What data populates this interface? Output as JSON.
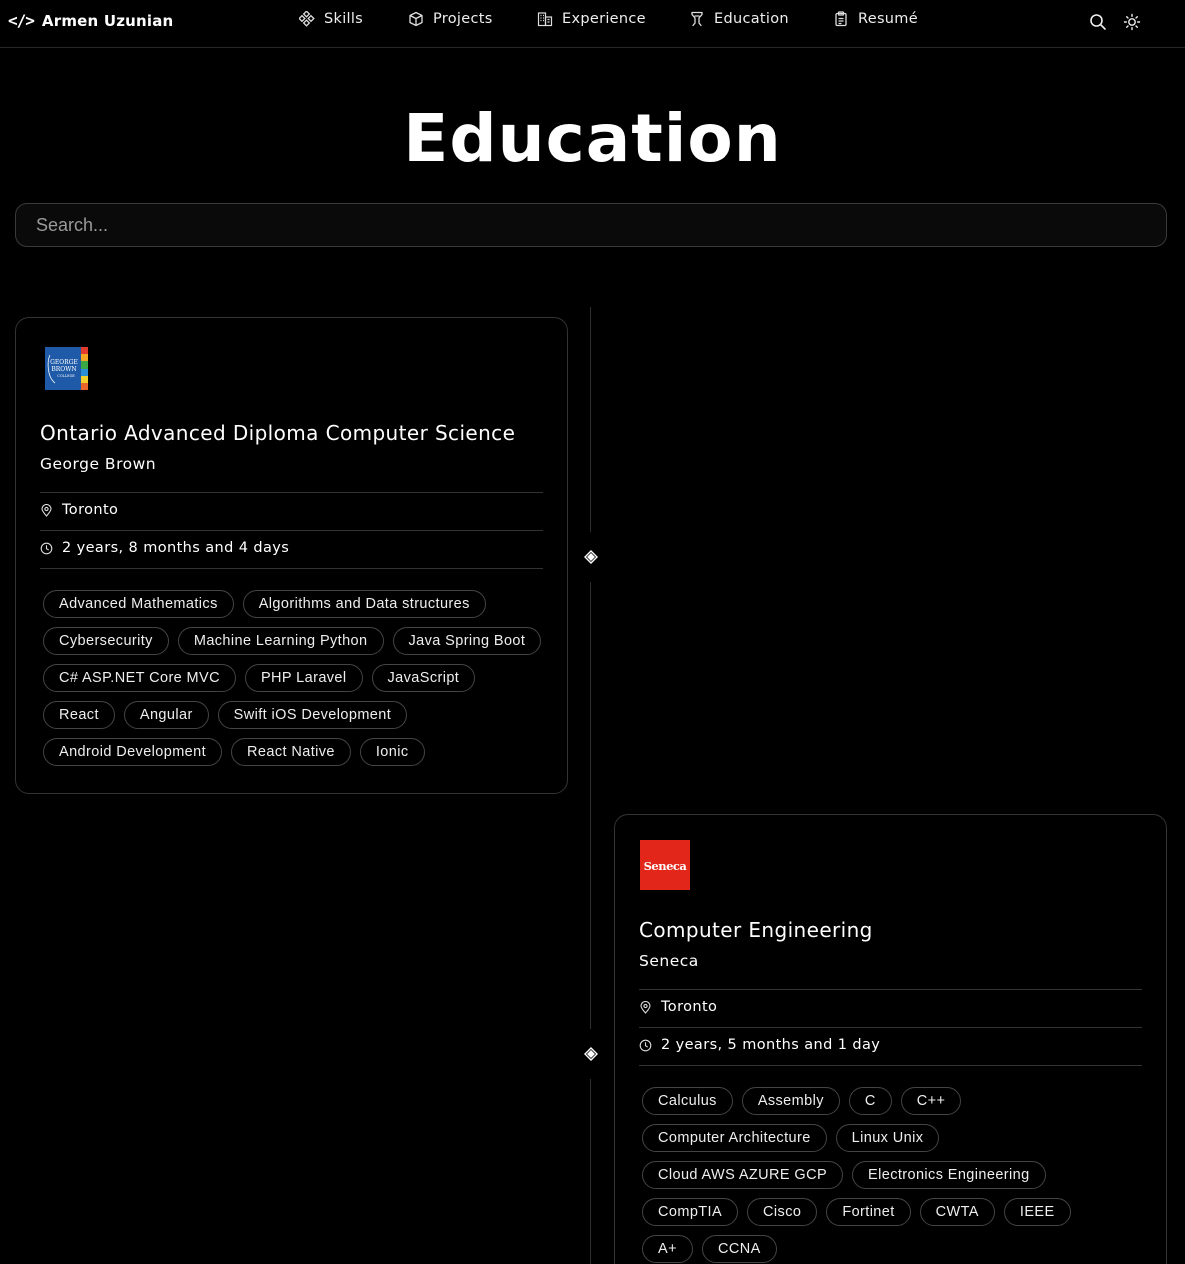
{
  "brand": {
    "name": "Armen Uzunian",
    "code_glyph": "</>"
  },
  "nav": {
    "items": [
      {
        "label": "Skills",
        "icon": "skills-icon"
      },
      {
        "label": "Projects",
        "icon": "cube-icon"
      },
      {
        "label": "Experience",
        "icon": "building-icon"
      },
      {
        "label": "Education",
        "icon": "education-icon"
      },
      {
        "label": "Resumé",
        "icon": "clipboard-icon"
      }
    ],
    "actions": [
      "search-icon",
      "sun-icon"
    ]
  },
  "page": {
    "title": "Education"
  },
  "search": {
    "placeholder": "Search..."
  },
  "education": [
    {
      "logo_text": "GEORGE BROWN",
      "degree": "Ontario Advanced Diploma Computer Science",
      "school": "George Brown",
      "location": "Toronto",
      "duration": "2 years, 8 months and 4 days",
      "tags": [
        "Advanced Mathematics",
        "Algorithms and Data structures",
        "Cybersecurity",
        "Machine Learning Python",
        "Java Spring Boot",
        "C# ASP.NET Core MVC",
        "PHP Laravel",
        "JavaScript",
        "React",
        "Angular",
        "Swift iOS Development",
        "Android Development",
        "React Native",
        "Ionic"
      ]
    },
    {
      "logo_text": "Seneca",
      "degree": "Computer Engineering",
      "school": "Seneca",
      "location": "Toronto",
      "duration": "2 years, 5 months and 1 day",
      "tags": [
        "Calculus",
        "Assembly",
        "C",
        "C++",
        "Computer Architecture",
        "Linux Unix",
        "Cloud AWS AZURE GCP",
        "Electronics Engineering",
        "CompTIA",
        "Cisco",
        "Fortinet",
        "CWTA",
        "IEEE",
        "A+",
        "CCNA"
      ]
    }
  ],
  "colors": {
    "background": "#000000",
    "text": "#ffffff",
    "border": "#333333",
    "seneca_red": "#e3261a",
    "gb_blue": "#1e5aa8"
  }
}
